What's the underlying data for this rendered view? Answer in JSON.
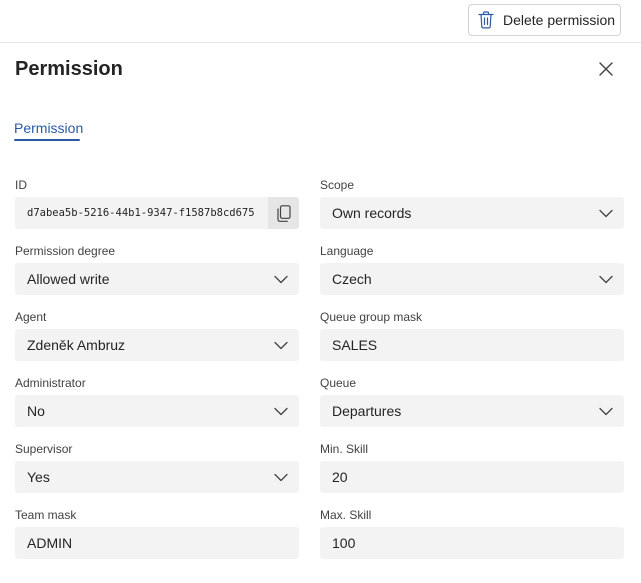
{
  "toolbar": {
    "delete_label": "Delete permission"
  },
  "panel": {
    "title": "Permission"
  },
  "tabs": [
    {
      "label": "Permission"
    }
  ],
  "form": {
    "id": {
      "label": "ID",
      "value": "d7abea5b-5216-44b1-9347-f1587b8cd675"
    },
    "scope": {
      "label": "Scope",
      "value": "Own records"
    },
    "permission_degree": {
      "label": "Permission degree",
      "value": "Allowed write"
    },
    "language": {
      "label": "Language",
      "value": "Czech"
    },
    "agent": {
      "label": "Agent",
      "value": "Zdeněk Ambruz"
    },
    "queue_group_mask": {
      "label": "Queue group mask",
      "value": "SALES"
    },
    "administrator": {
      "label": "Administrator",
      "value": "No"
    },
    "queue": {
      "label": "Queue",
      "value": "Departures"
    },
    "supervisor": {
      "label": "Supervisor",
      "value": "Yes"
    },
    "min_skill": {
      "label": "Min. Skill",
      "value": "20"
    },
    "team_mask": {
      "label": "Team mask",
      "value": "ADMIN"
    },
    "max_skill": {
      "label": "Max. Skill",
      "value": "100"
    }
  },
  "icons": {
    "delete": "trash-icon",
    "close": "close-icon",
    "copy": "copy-icon",
    "dropdown": "chevron-down-icon"
  },
  "colors": {
    "accent": "#2b5aa3",
    "field_bg": "#f3f3f3",
    "text": "#242424"
  }
}
